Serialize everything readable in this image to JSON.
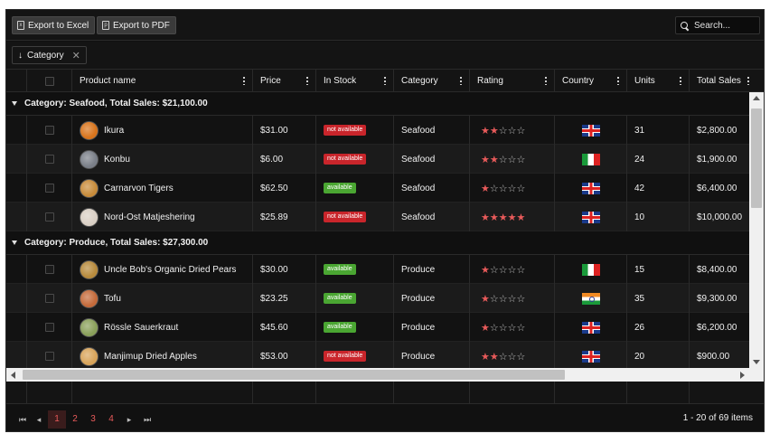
{
  "toolbar": {
    "export_excel": "Export to Excel",
    "export_pdf": "Export to PDF",
    "search_placeholder": "Search..."
  },
  "grouping": {
    "chip_label": "Category"
  },
  "columns": [
    "Product name",
    "Price",
    "In Stock",
    "Category",
    "Rating",
    "Country",
    "Units",
    "Total Sales"
  ],
  "groups": [
    {
      "label": "Category: Seafood, Total Sales: $21,100.00",
      "rows": [
        {
          "name": "Ikura",
          "price": "$31.00",
          "stock": "not available",
          "in_stock": false,
          "category": "Seafood",
          "rating": 2,
          "country": "uk",
          "units": "31",
          "total": "$2,800.00",
          "img": "#d8741c"
        },
        {
          "name": "Konbu",
          "price": "$6.00",
          "stock": "not available",
          "in_stock": false,
          "category": "Seafood",
          "rating": 2,
          "country": "it",
          "units": "24",
          "total": "$1,900.00",
          "img": "#7a7f88"
        },
        {
          "name": "Carnarvon Tigers",
          "price": "$62.50",
          "stock": "available",
          "in_stock": true,
          "category": "Seafood",
          "rating": 1,
          "country": "uk",
          "units": "42",
          "total": "$6,400.00",
          "img": "#c78b3a"
        },
        {
          "name": "Nord-Ost Matjeshering",
          "price": "$25.89",
          "stock": "not available",
          "in_stock": false,
          "category": "Seafood",
          "rating": 5,
          "country": "uk",
          "units": "10",
          "total": "$10,000.00",
          "img": "#d9cfc4"
        }
      ]
    },
    {
      "label": "Category: Produce, Total Sales: $27,300.00",
      "rows": [
        {
          "name": "Uncle Bob's Organic Dried Pears",
          "price": "$30.00",
          "stock": "available",
          "in_stock": true,
          "category": "Produce",
          "rating": 1,
          "country": "it",
          "units": "15",
          "total": "$8,400.00",
          "img": "#b78a3c"
        },
        {
          "name": "Tofu",
          "price": "$23.25",
          "stock": "available",
          "in_stock": true,
          "category": "Produce",
          "rating": 1,
          "country": "in",
          "units": "35",
          "total": "$9,300.00",
          "img": "#c46a3a"
        },
        {
          "name": "Rössle Sauerkraut",
          "price": "$45.60",
          "stock": "available",
          "in_stock": true,
          "category": "Produce",
          "rating": 1,
          "country": "uk",
          "units": "26",
          "total": "$6,200.00",
          "img": "#8aa05a"
        },
        {
          "name": "Manjimup Dried Apples",
          "price": "$53.00",
          "stock": "not available",
          "in_stock": false,
          "category": "Produce",
          "rating": 2,
          "country": "uk",
          "units": "20",
          "total": "$900.00",
          "img": "#d8a45a"
        }
      ]
    }
  ],
  "pager": {
    "pages": [
      "1",
      "2",
      "3",
      "4"
    ],
    "active": "1",
    "info": "1 - 20 of 69 items"
  },
  "colors": {
    "accent": "#e85a5a",
    "badge_red": "#c9252b",
    "badge_green": "#4aa632"
  }
}
